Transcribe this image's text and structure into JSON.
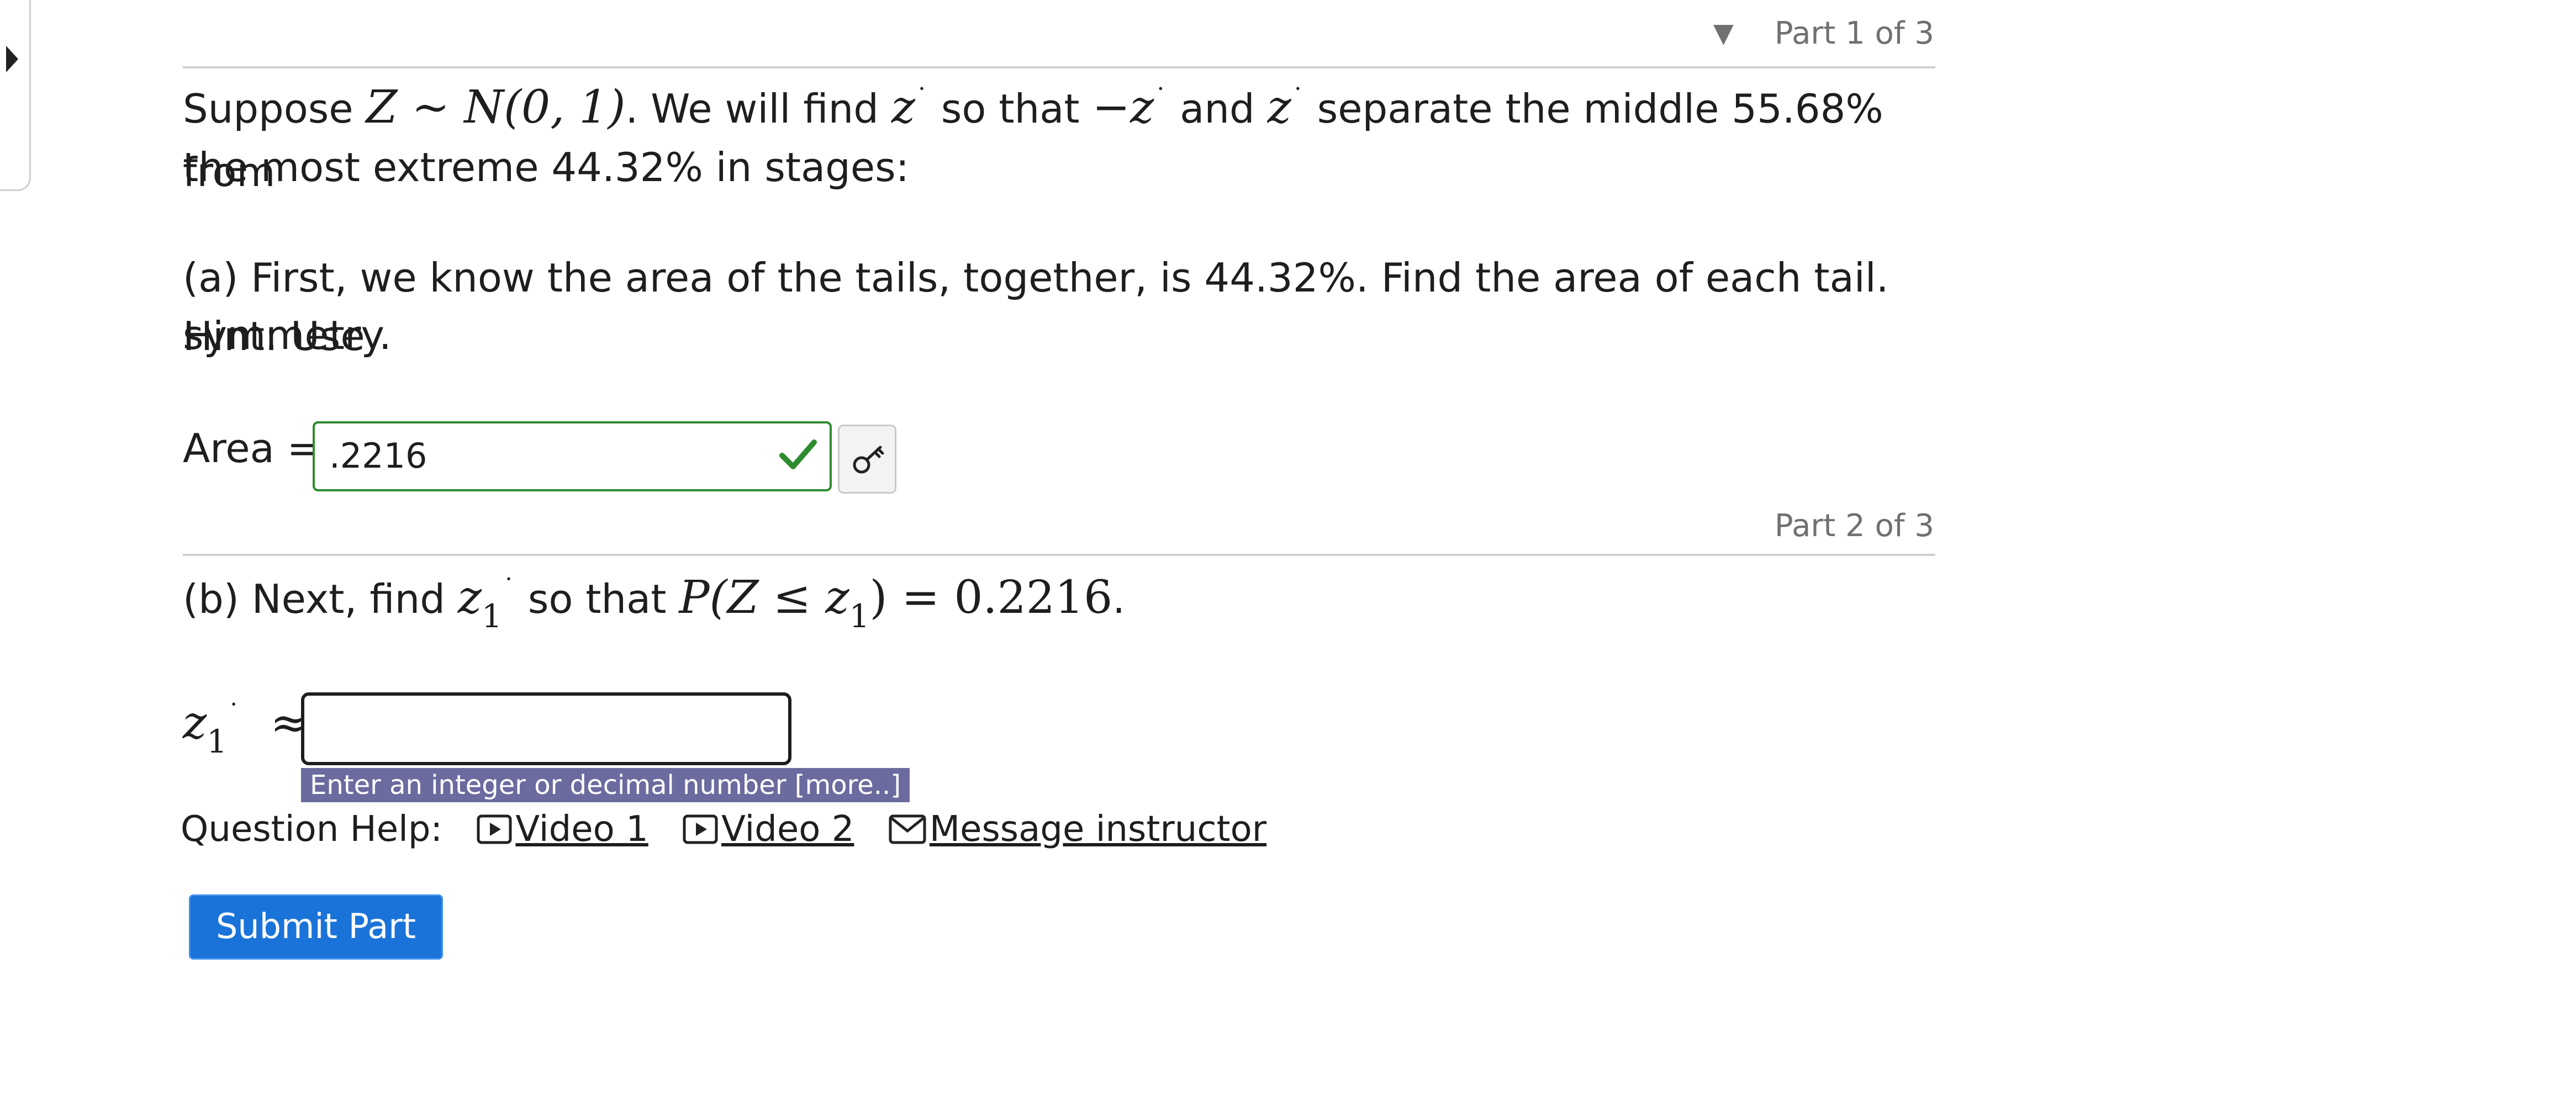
{
  "parts": {
    "part1_label": "Part 1 of 3",
    "part2_label": "Part 2 of 3",
    "collapse_icon": "triangle-down-icon"
  },
  "intro": {
    "t1": "Suppose ",
    "m1": "Z ∼ N(0, 1)",
    "t2": ". We will find ",
    "m2": "z",
    "t3": " so that ",
    "m3": "−z",
    "t4": " and ",
    "m4": "z",
    "t5": " separate the middle 55.68% from",
    "line2": "the most extreme 44.32% in stages:"
  },
  "part_a": {
    "line1": "(a) First, we know the area of the tails, together, is 44.32%. Find the area of each tail. Hint: Use",
    "line2": "symmetry.",
    "area_label": "Area =",
    "area_value": ".2216",
    "status_icon": "check-icon",
    "key_icon": "key-icon"
  },
  "part_b": {
    "t1": "(b) Next, find ",
    "m_z": "z",
    "sub1": "1",
    "t2": " so that ",
    "m_p": "P(Z ≤ z",
    "sub2": "1",
    "m_p_end": ") = 0.2216",
    "t3": ".",
    "answer_var": "z",
    "answer_sub": "1",
    "approx": "≈",
    "answer_value": "",
    "hint": "Enter an integer or decimal number [more..]"
  },
  "help": {
    "label": "Question Help:",
    "video1": "Video 1",
    "video2": "Video 2",
    "message": "Message instructor"
  },
  "submit_label": "Submit Part",
  "colors": {
    "accent": "#1a73d9",
    "correct": "#2e8b2e",
    "hint_bg": "#6b6b9f"
  }
}
